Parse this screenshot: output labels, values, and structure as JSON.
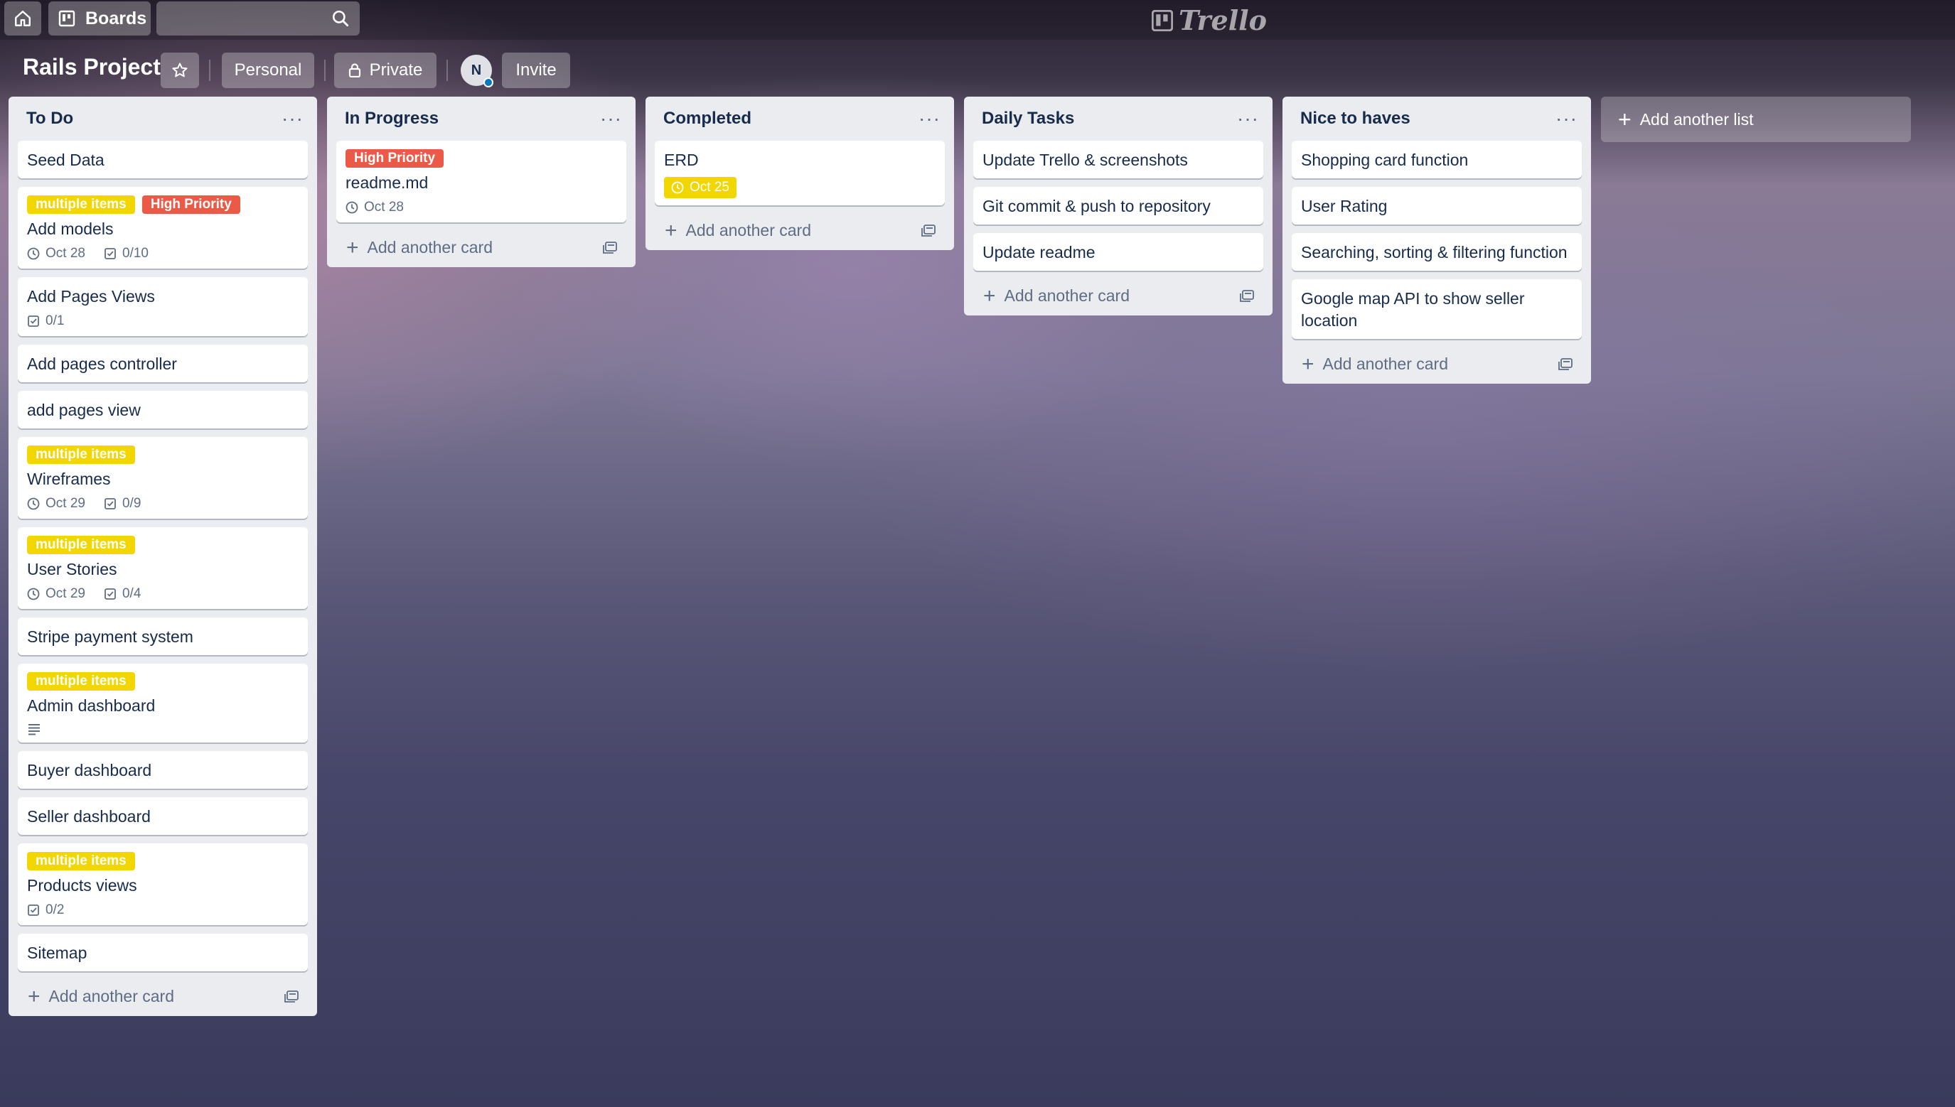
{
  "topnav": {
    "home_icon": "home-icon",
    "boards_label": "Boards",
    "search_placeholder": "",
    "logo_text": "Trello"
  },
  "board": {
    "title": "Rails Project",
    "visibility_team": "Personal",
    "visibility": "Private",
    "member_initial": "N",
    "invite_label": "Invite"
  },
  "colors": {
    "label_yellow": "#f2d600",
    "label_red": "#eb5a46",
    "list_bg": "#ebecf0"
  },
  "lists": [
    {
      "title": "To Do",
      "cards": [
        {
          "title": "Seed Data"
        },
        {
          "labels": [
            "multiple items",
            "High Priority"
          ],
          "title": "Add models",
          "due": "Oct 28",
          "checklist": "0/10"
        },
        {
          "title": "Add Pages Views",
          "checklist": "0/1"
        },
        {
          "title": "Add pages controller"
        },
        {
          "title": "add pages view"
        },
        {
          "labels": [
            "multiple items"
          ],
          "title": "Wireframes",
          "due": "Oct 29",
          "checklist": "0/9"
        },
        {
          "labels": [
            "multiple items"
          ],
          "title": "User Stories",
          "due": "Oct 29",
          "checklist": "0/4"
        },
        {
          "title": "Stripe payment system"
        },
        {
          "labels": [
            "multiple items"
          ],
          "title": "Admin dashboard"
        },
        {
          "title": "Buyer dashboard"
        },
        {
          "title": "Seller dashboard"
        },
        {
          "labels": [
            "multiple items"
          ],
          "title": "Products views",
          "checklist": "0/2"
        },
        {
          "title": "Sitemap"
        }
      ],
      "add_card": "Add another card"
    },
    {
      "title": "In Progress",
      "cards": [
        {
          "labels": [
            "High Priority"
          ],
          "title": "readme.md",
          "due": "Oct 28"
        }
      ],
      "add_card": "Add another card"
    },
    {
      "title": "Completed",
      "cards": [
        {
          "title": "ERD",
          "due": "Oct 25"
        }
      ],
      "add_card": "Add another card"
    },
    {
      "title": "Daily Tasks",
      "cards": [
        {
          "title": "Update Trello & screenshots"
        },
        {
          "title": "Git commit & push to repository"
        },
        {
          "title": "Update readme"
        }
      ],
      "add_card": "Add another card"
    },
    {
      "title": "Nice to haves",
      "cards": [
        {
          "title": "Shopping card function"
        },
        {
          "title": "User Rating"
        },
        {
          "title": "Searching, sorting & filtering function"
        },
        {
          "title": "Google map API to show seller location"
        }
      ],
      "add_card": "Add another card"
    }
  ],
  "add_list": "Add another list"
}
